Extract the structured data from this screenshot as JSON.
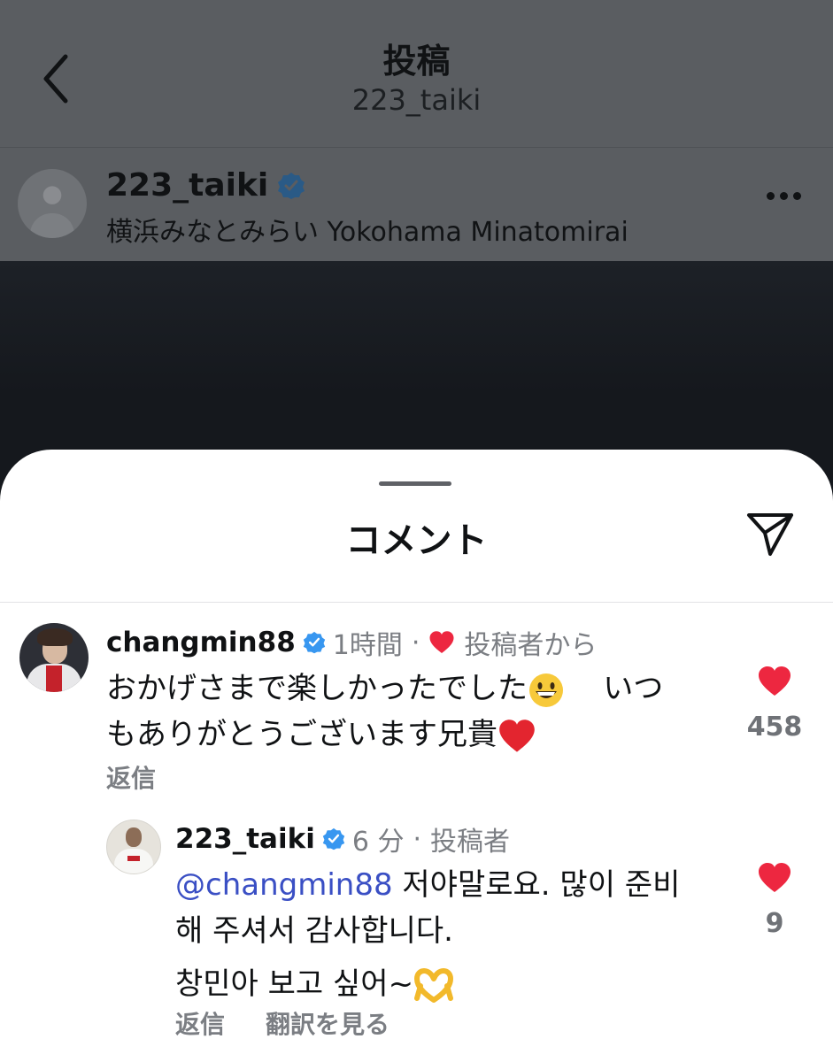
{
  "header": {
    "title": "投稿",
    "subtitle": "223_taiki",
    "back_icon": "chevron-left-icon"
  },
  "post": {
    "username": "223_taiki",
    "location": "横浜みなとみらい Yokohama Minatomirai",
    "more_icon": "more-horizontal-icon"
  },
  "sheet": {
    "title": "コメント",
    "share_icon": "send-icon"
  },
  "comments": [
    {
      "username": "changmin88",
      "time": "1時間",
      "author_liked_label": "投稿者から",
      "text_line1": "おかげさまで楽しかったでした",
      "text_line1_tail": "いつ",
      "text_line2": "もありがとうございます兄貴",
      "emoji1": "grinning-face-icon",
      "emoji2": "red-heart-icon",
      "likes": "458",
      "reply_label": "返信"
    },
    {
      "username": "223_taiki",
      "time": "6 分",
      "author_label": "投稿者",
      "mention": "@changmin88",
      "text_line1": "저야말로요. 많이 준비",
      "text_line2": "해 주셔서 감사합니다.",
      "text_line3": "창민아 보고 싶어~",
      "emoji": "heart-hands-icon",
      "likes": "9",
      "reply_label": "返信",
      "translate_label": "翻訳を見る"
    }
  ],
  "colors": {
    "heart": "#ed2740",
    "verified": "#3897f0",
    "mention": "#3a4fc4",
    "secondary_text": "#7b7e83"
  }
}
